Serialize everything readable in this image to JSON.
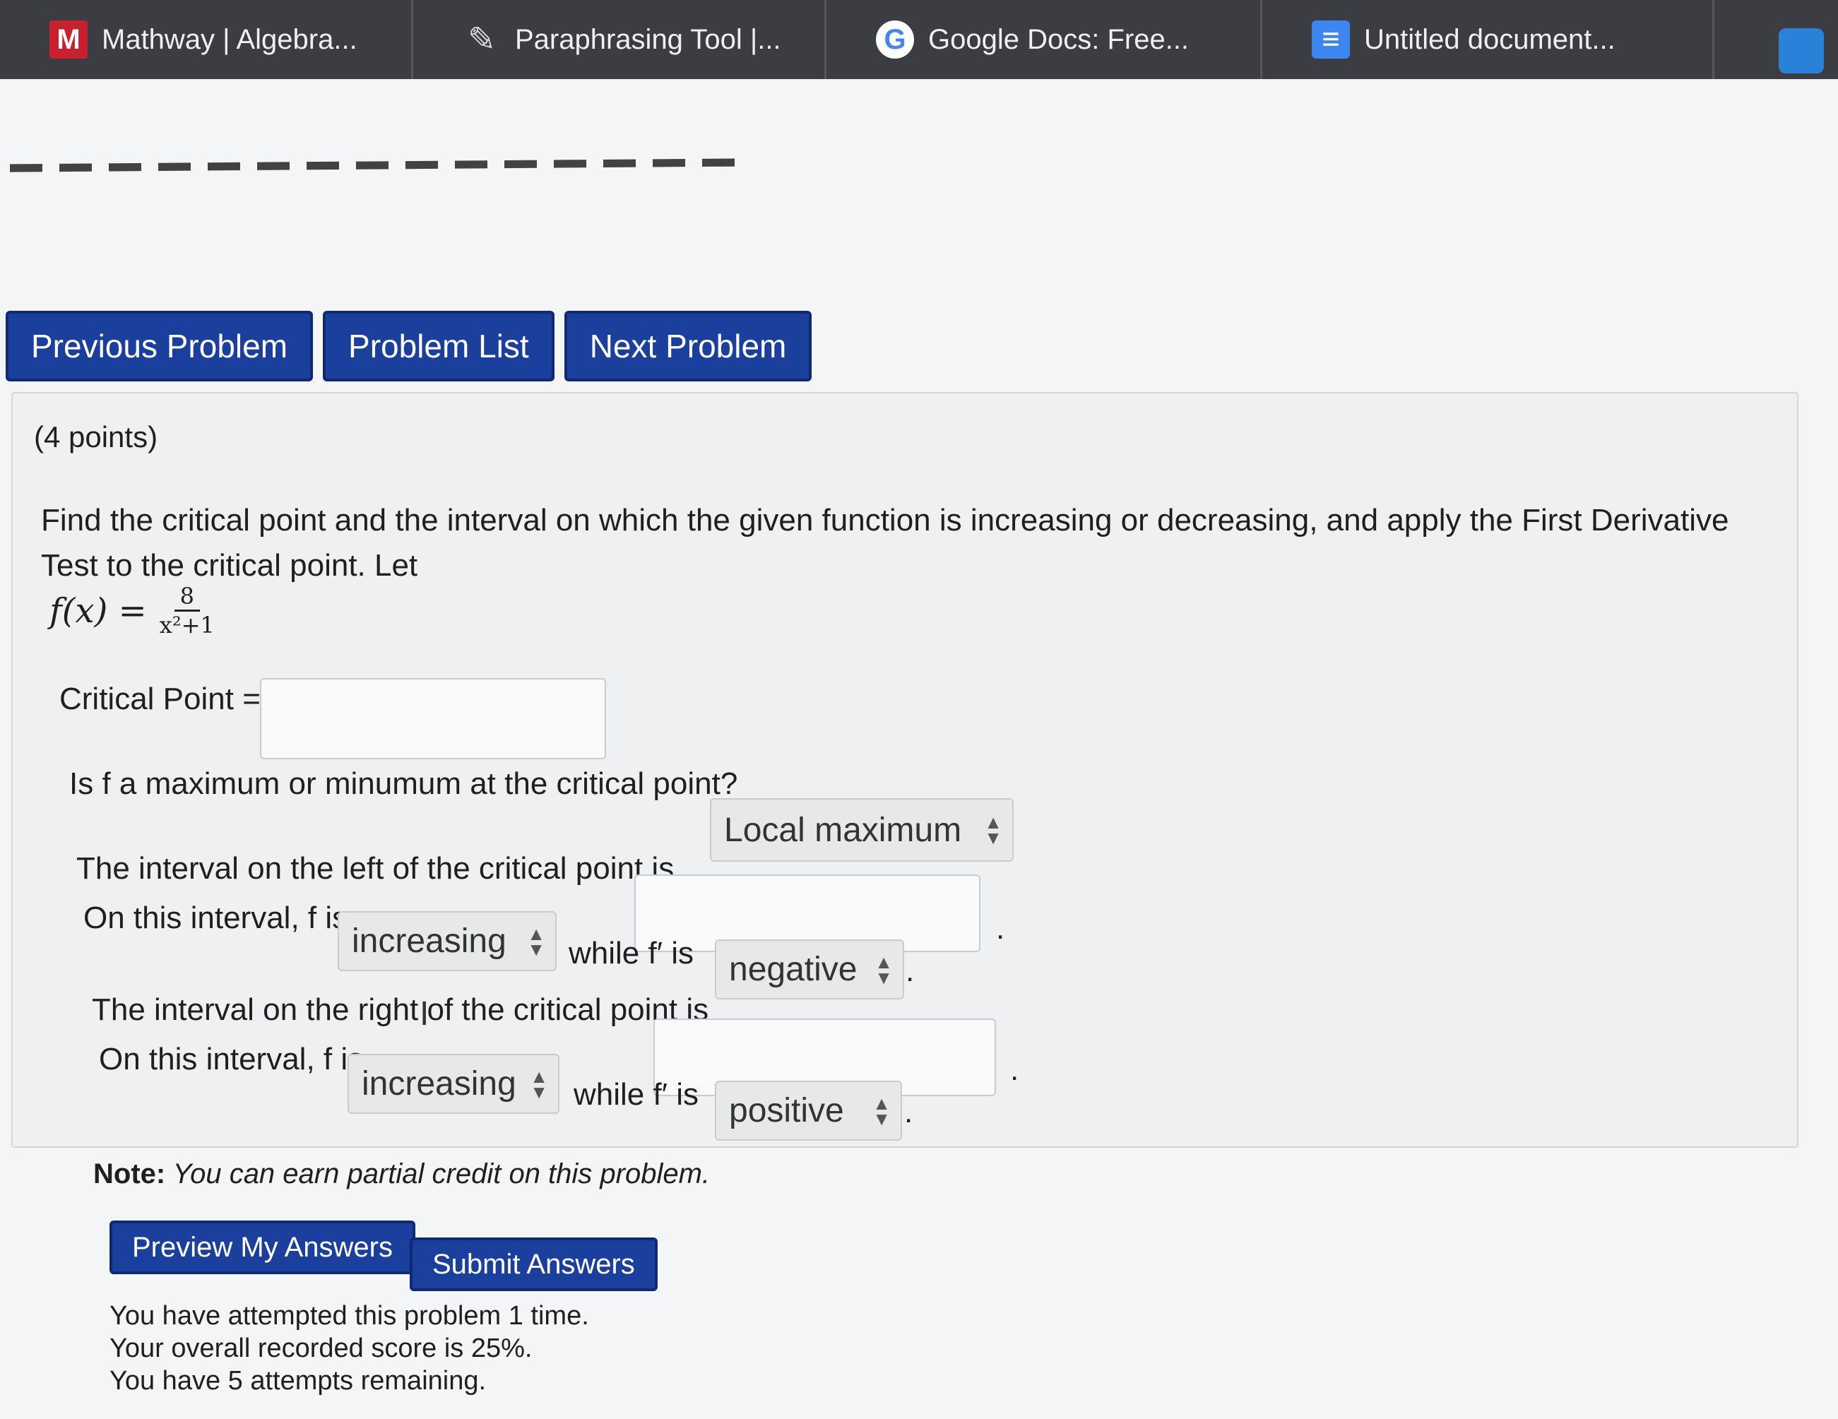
{
  "tabs": [
    {
      "title": "Mathway | Algebra...",
      "icon": "mathway-icon"
    },
    {
      "title": "Paraphrasing Tool |...",
      "icon": "pen-icon"
    },
    {
      "title": "Google Docs: Free...",
      "icon": "google-icon"
    },
    {
      "title": "Untitled document...",
      "icon": "docs-icon"
    }
  ],
  "nav": {
    "previous": "Previous Problem",
    "list": "Problem List",
    "next": "Next Problem"
  },
  "problem": {
    "points": "(4 points)",
    "statement": "Find the critical point and the interval on which the given function is increasing or decreasing, and apply the First Derivative Test to the critical point. Let",
    "function_lhs": "f(x) =",
    "function_num": "8",
    "function_den": "x²+1",
    "critical_point_label": "Critical Point =",
    "critical_point_value": "",
    "maxmin_question": "Is f a maximum or minumum at the critical point?",
    "maxmin_selected": "Local maximum",
    "left_interval_label": "The interval on the left of the critical point is",
    "left_interval_value": "",
    "left_on_interval": "On this interval, f is",
    "left_f_selected": "increasing",
    "left_while": "while f′ is",
    "left_fprime_selected": "negative",
    "right_interval_label": "The interval on the right of the critical point is",
    "right_interval_value": "",
    "right_on_interval": "On this interval, f is",
    "right_f_selected": "increasing",
    "right_while": "while f′ is",
    "right_fprime_selected": "positive",
    "period": "."
  },
  "note": {
    "bold": "Note:",
    "text": " You can earn partial credit on this problem."
  },
  "actions": {
    "preview": "Preview My Answers",
    "submit": "Submit Answers"
  },
  "status": {
    "line1": "You have attempted this problem 1 time.",
    "line2": "Your overall recorded score is 25%.",
    "line3": "You have 5 attempts remaining."
  }
}
